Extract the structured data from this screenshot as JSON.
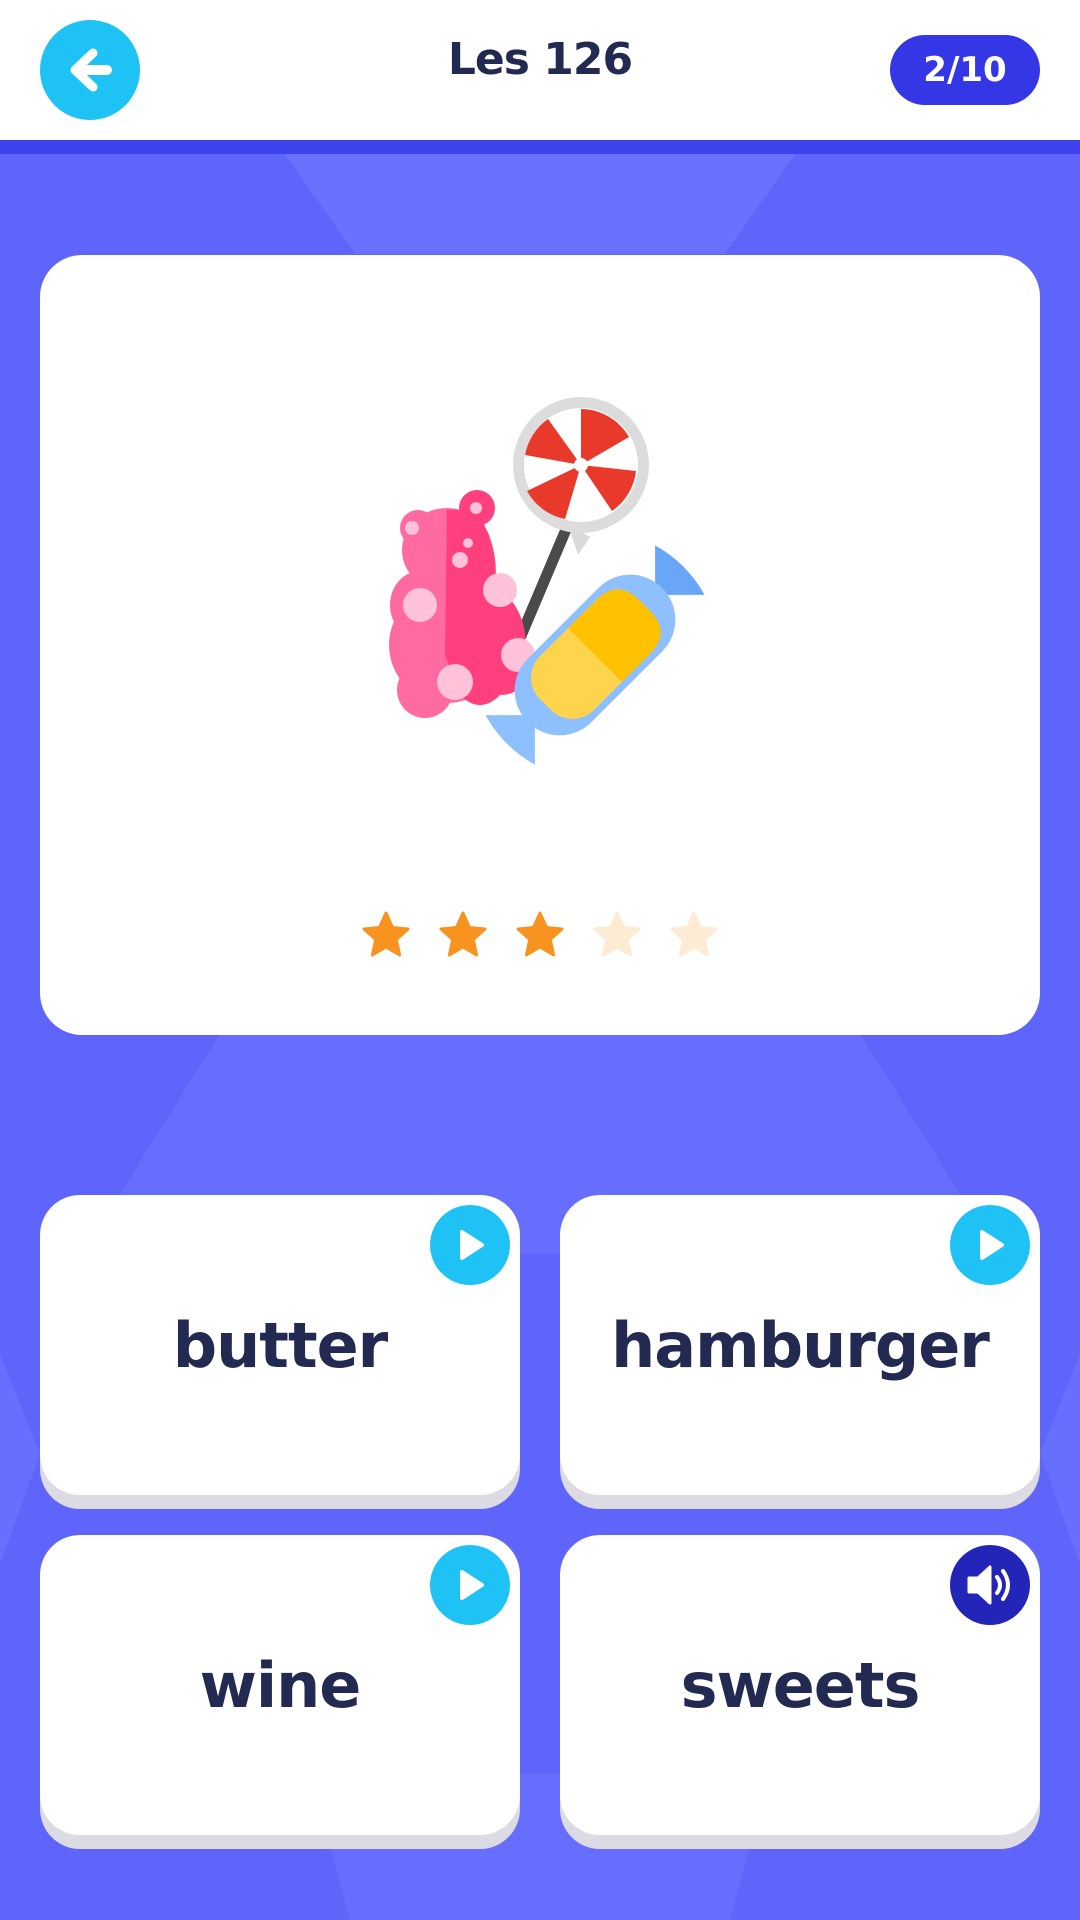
{
  "header": {
    "title": "Les 126",
    "progress": "2/10",
    "back_icon": "arrow-left-icon"
  },
  "question": {
    "illustration": "candy-sweets-illustration",
    "rating": {
      "filled": 3,
      "total": 5
    }
  },
  "answers": [
    {
      "label": "butter",
      "audio_icon": "play-icon"
    },
    {
      "label": "hamburger",
      "audio_icon": "play-icon"
    },
    {
      "label": "wine",
      "audio_icon": "play-icon"
    },
    {
      "label": "sweets",
      "audio_icon": "speaker-icon"
    }
  ],
  "colors": {
    "background": "#5f64fb",
    "accent_cyan": "#1ec2f5",
    "badge": "#3537e6",
    "text_dark": "#232a52",
    "star_filled": "#f7931e",
    "star_empty": "#fdebd3",
    "audio_playing": "#2324b8"
  }
}
